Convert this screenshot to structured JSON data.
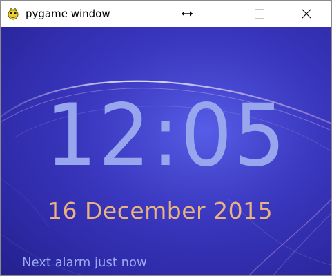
{
  "window": {
    "title": "pygame window",
    "controls": {
      "resize_icon": "resize-horizontal-icon",
      "minimize_icon": "minimize-icon",
      "maximize_icon": "maximize-icon",
      "close_icon": "close-icon"
    }
  },
  "clock": {
    "time": "12:05",
    "date": "16 December 2015",
    "alarm": "Next alarm just now"
  },
  "colors": {
    "background": "#3b38c2",
    "time_text": "#98a6ee",
    "date_text": "#e9b27e",
    "alarm_text": "#9aa9f0"
  }
}
